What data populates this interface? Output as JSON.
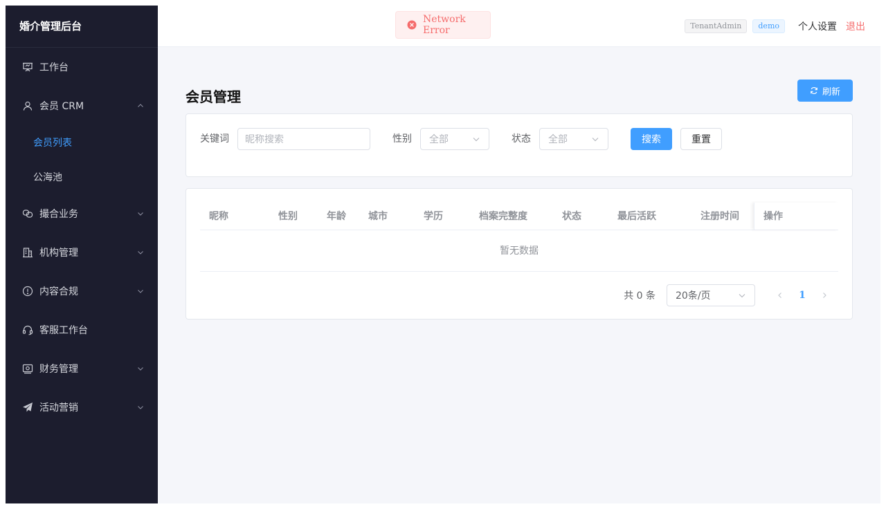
{
  "sidebar": {
    "brand": "婚介管理后台",
    "items": [
      {
        "label": "工作台",
        "icon": "presentation-board-icon"
      },
      {
        "label": "会员 CRM",
        "icon": "user-icon",
        "expanded": true,
        "children": [
          {
            "label": "会员列表",
            "active": true
          },
          {
            "label": "公海池"
          }
        ]
      },
      {
        "label": "撮合业务",
        "icon": "link-icon"
      },
      {
        "label": "机构管理",
        "icon": "building-icon"
      },
      {
        "label": "内容合规",
        "icon": "warning-circle-icon"
      },
      {
        "label": "客服工作台",
        "icon": "headset-icon"
      },
      {
        "label": "财务管理",
        "icon": "wallet-icon"
      },
      {
        "label": "活动营销",
        "icon": "send-plane-icon"
      }
    ]
  },
  "toast": {
    "text": "Network Error",
    "type": "error",
    "color": "#f56c6c"
  },
  "header": {
    "role_tag": "TenantAdmin",
    "tenant_tag": "demo",
    "settings_label": "个人设置",
    "logout_label": "退出"
  },
  "page": {
    "title": "会员管理",
    "refresh_label": "刷新"
  },
  "filters": {
    "keyword_label": "关键词",
    "keyword_placeholder": "昵称搜索",
    "keyword_value": "",
    "gender_label": "性别",
    "gender_value": "全部",
    "status_label": "状态",
    "status_value": "全部",
    "search_label": "搜索",
    "reset_label": "重置"
  },
  "table": {
    "columns": [
      "昵称",
      "性别",
      "年龄",
      "城市",
      "学历",
      "档案完整度",
      "状态",
      "最后活跃",
      "注册时间",
      "操作"
    ],
    "rows": [],
    "empty_text": "暂无数据"
  },
  "pagination": {
    "total_text": "共 0 条",
    "page_size": "20条/页",
    "current_page": "1"
  },
  "colors": {
    "sidebar_bg": "#1c1d2e",
    "primary": "#409eff",
    "danger": "#f56c6c",
    "page_bg": "#f5f6fa"
  }
}
